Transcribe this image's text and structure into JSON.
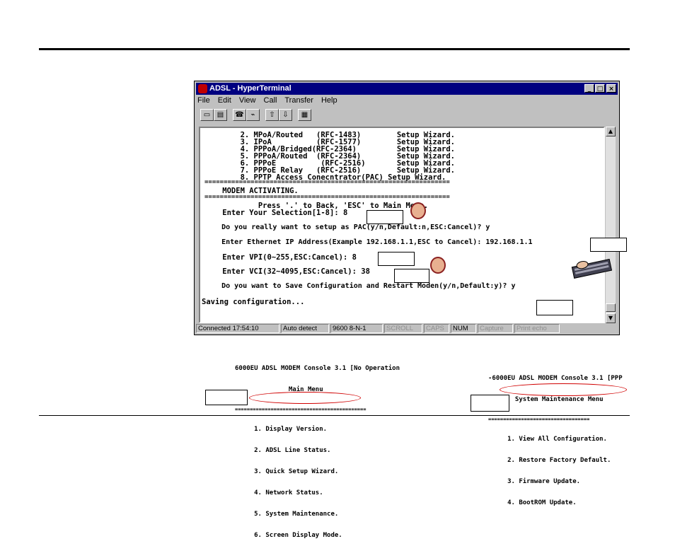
{
  "window": {
    "title": "ADSL - HyperTerminal",
    "menu": [
      "File",
      "Edit",
      "View",
      "Call",
      "Transfer",
      "Help"
    ],
    "status": {
      "connected": "Connected 17:54:10",
      "detect": "Auto detect",
      "settings": "9600 8-N-1",
      "scroll": "SCROLL",
      "caps": "CAPS",
      "num": "NUM",
      "capture": "Capture",
      "print": "Print echo"
    }
  },
  "terminal": {
    "lines": [
      "        2. MPoA/Routed   (RFC-1483)        Setup Wizard.",
      "        3. IPoA          (RFC-1577)        Setup Wizard.",
      "        4. PPPoA/Bridged(RFC-2364)         Setup Wizard.",
      "        5. PPPoA/Routed  (RFC-2364)        Setup Wizard.",
      "        6. PPPoE          (RFC-2516)       Setup Wizard.",
      "        7. PPPoE Relay   (RFC-2516)        Setup Wizard.",
      "        8. PPTP Access Conecntrator(PAC) Setup Wizard.",
      "================================================================",
      "    MODEM ACTIVATING.",
      "================================================================",
      "            Press '.' to Back, 'ESC' to Main Menu.",
      "    Enter Your Selection[1-8]: 8",
      "",
      "    Do you really want to setup as PAC(y/n,Default:n,ESC:Cancel)? y",
      "",
      "    Enter Ethernet IP Address(Example 192.168.1.1,ESC to Cancel): 192.168.1.1",
      "",
      "    Enter VPI(0~255,ESC:Cancel): 8",
      "",
      "    Enter VCI(32~4095,ESC:Cancel): 38",
      "",
      "    Do you want to Save Configuration and Restart Moden(y/n,Default:y)? y",
      "",
      "Saving configuration..."
    ]
  },
  "console_left": {
    "lines": [
      "6000EU ADSL MODEM Console 3.1 [No Operation",
      "              Main Menu",
      "============================================",
      "     1. Display Version.",
      "     2. ADSL Line Status.",
      "     3. Quick Setup Wizard.",
      "     4. Network Status.",
      "     5. System Maintenance.",
      "     6. Screen Display Mode."
    ]
  },
  "console_right": {
    "lines": [
      "-6000EU ADSL MODEM Console 3.1 [PPP",
      "       System Maintenance Menu",
      "==================================",
      "     1. View All Configuration.",
      "     2. Restore Factory Default.",
      "     3. Firmware Update.",
      "     4. BootROM Update."
    ]
  },
  "colors": {
    "titlebar": "#000080",
    "highlight": "#d00000"
  }
}
